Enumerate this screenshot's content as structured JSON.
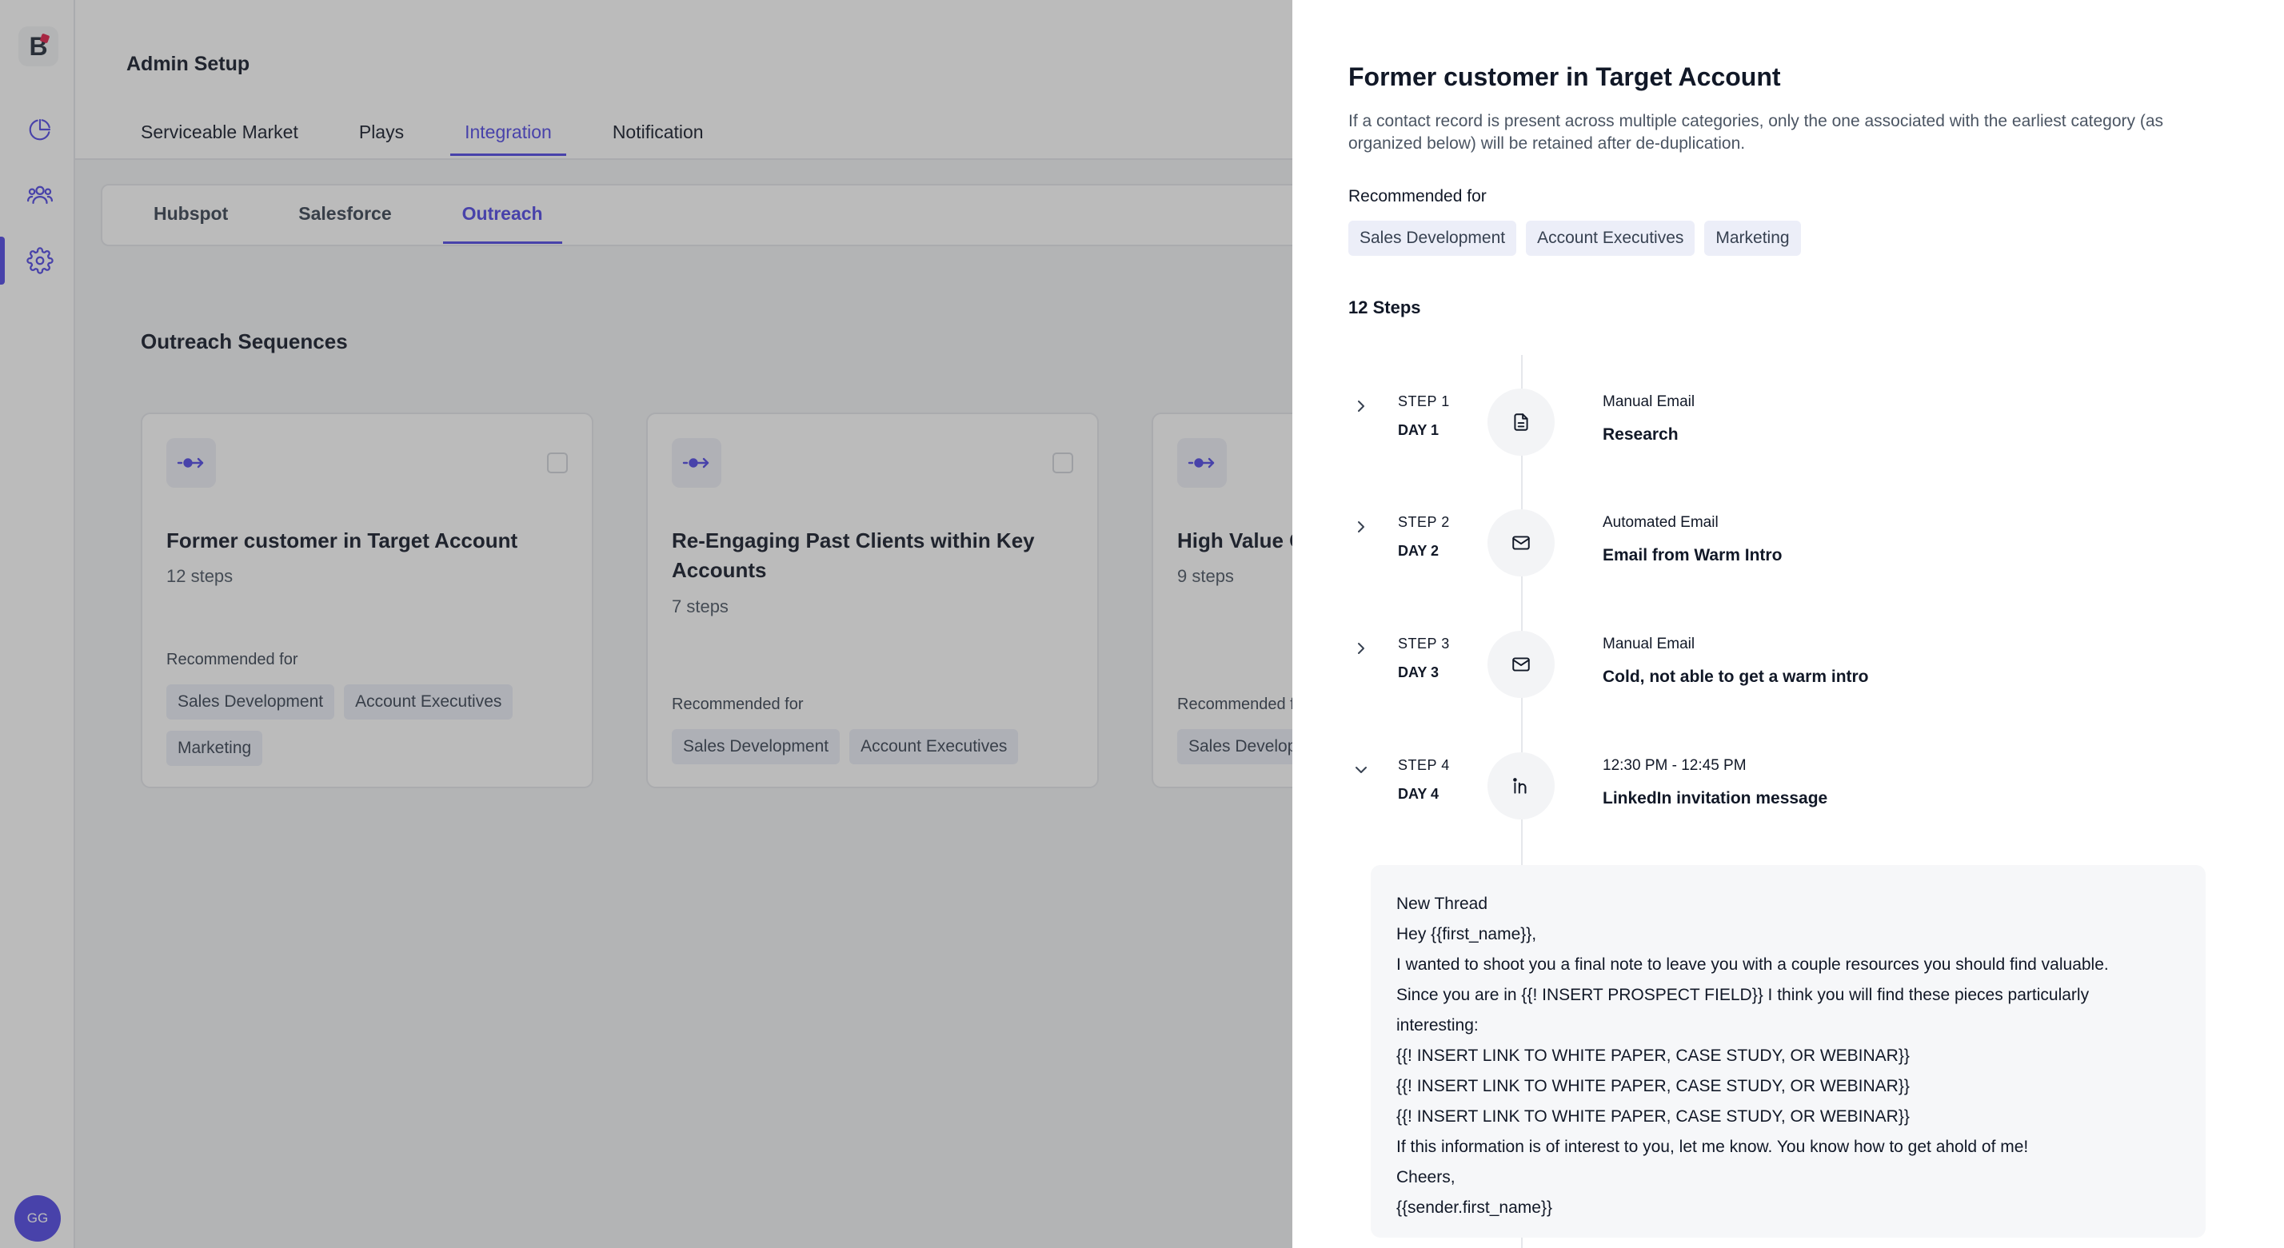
{
  "sidebar": {
    "logo_letter": "B",
    "nav": [
      {
        "icon": "chart-pie-icon"
      },
      {
        "icon": "users-icon"
      },
      {
        "icon": "gear-icon",
        "active": true
      }
    ],
    "avatar_initials": "GG"
  },
  "header": {
    "title": "Admin Setup",
    "tabs": [
      {
        "label": "Serviceable Market"
      },
      {
        "label": "Plays"
      },
      {
        "label": "Integration",
        "active": true
      },
      {
        "label": "Notification"
      }
    ]
  },
  "subtabs": [
    {
      "label": "Hubspot"
    },
    {
      "label": "Salesforce"
    },
    {
      "label": "Outreach",
      "active": true
    }
  ],
  "section_title": "Outreach Sequences",
  "cards": [
    {
      "title": "Former customer in Target Account",
      "steps": "12 steps",
      "recommended_label": "Recommended for",
      "chips": [
        "Sales Development",
        "Account Executives",
        "Marketing"
      ]
    },
    {
      "title": "Re-Engaging Past Clients within Key Accounts",
      "steps": "7 steps",
      "recommended_label": "Recommended for",
      "chips": [
        "Sales Development",
        "Account Executives"
      ]
    },
    {
      "title": "High Value C",
      "steps": "9 steps",
      "recommended_label": "Recommended f",
      "chips": [
        "Sales Develop"
      ]
    }
  ],
  "drawer": {
    "title": "Former customer in Target Account",
    "description": "If a contact record is present across multiple categories, only the one associated with the earliest category (as organized below) will be retained after de-duplication.",
    "recommended_label": "Recommended for",
    "chips": [
      "Sales Development",
      "Account Executives",
      "Marketing"
    ],
    "steps_count": "12 Steps",
    "steps": [
      {
        "step": "STEP 1",
        "day": "DAY 1",
        "type": "Manual Email",
        "name": "Research",
        "icon": "document-icon",
        "expanded": false
      },
      {
        "step": "STEP 2",
        "day": "DAY 2",
        "type": "Automated Email",
        "name": "Email from Warm Intro",
        "icon": "mail-icon",
        "expanded": false
      },
      {
        "step": "STEP 3",
        "day": "DAY 3",
        "type": "Manual Email",
        "name": "Cold, not able to get a warm intro",
        "icon": "mail-icon",
        "expanded": false
      },
      {
        "step": "STEP 4",
        "day": "DAY 4",
        "type": "12:30 PM - 12:45 PM",
        "name": "LinkedIn invitation message",
        "icon": "linkedin-icon",
        "expanded": true
      }
    ],
    "thread": [
      "New Thread",
      "Hey {{first_name}},",
      "I wanted to shoot you a final note to leave you with a couple resources you should find valuable.",
      "Since you are in {{! INSERT PROSPECT FIELD}} I think you will find these pieces particularly",
      "interesting:",
      "{{! INSERT LINK TO WHITE PAPER, CASE STUDY, OR WEBINAR}}",
      "{{! INSERT LINK TO WHITE PAPER, CASE STUDY, OR WEBINAR}}",
      "{{! INSERT LINK TO WHITE PAPER, CASE STUDY, OR WEBINAR}}",
      "If this information is of interest to you, let me know. You know how to get ahold of me!",
      "Cheers,",
      "{{sender.first_name}}"
    ]
  },
  "colors": {
    "accent": "#4f46e5",
    "chip_bg": "#eceef8",
    "overlay": "rgba(60,60,60,0.35)"
  }
}
